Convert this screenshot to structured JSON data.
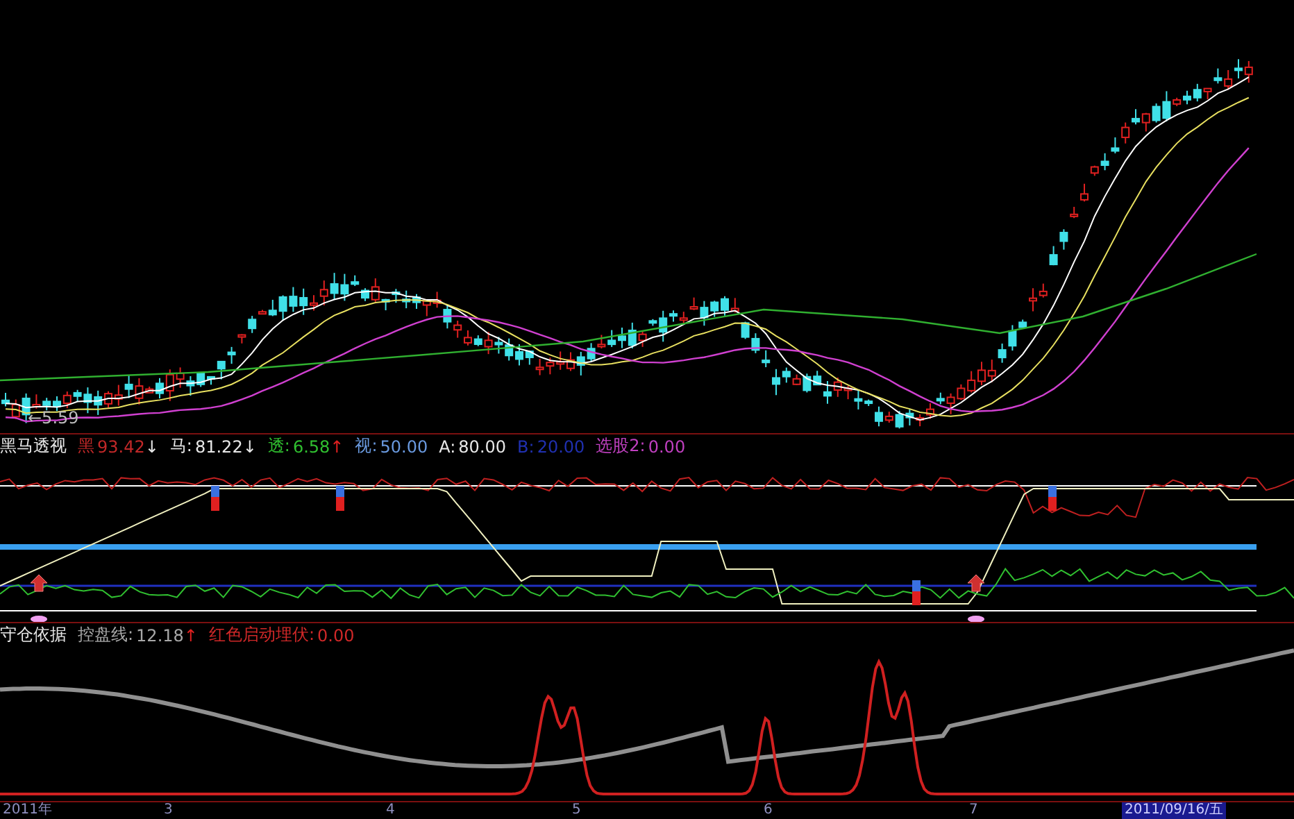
{
  "price_panel": {
    "low_marker": "←5.59"
  },
  "indicator_panel": {
    "title": "黑马透视",
    "items": [
      {
        "label": "黑",
        "value": "93.42",
        "arrow": "↓",
        "color": "#c02828"
      },
      {
        "label": "马:",
        "value": "81.22",
        "arrow": "↓",
        "color": "#e8e8e8"
      },
      {
        "label": "透:",
        "value": "6.58",
        "arrow": "↑",
        "color": "#30c030"
      },
      {
        "label": "视:",
        "value": "50.00",
        "color": "#6a9ae0"
      },
      {
        "label": "A:",
        "value": "80.00",
        "color": "#e8e8e8"
      },
      {
        "label": "B:",
        "value": "20.00",
        "color": "#2030b0"
      },
      {
        "label": "选股2:",
        "value": "0.00",
        "color": "#c040c0"
      }
    ]
  },
  "position_panel": {
    "title": "守仓依据",
    "items": [
      {
        "label": "控盘线:",
        "value": "12.18",
        "arrow": "↑",
        "color": "#a8a8a8"
      },
      {
        "label": "红色启动埋伏:",
        "value": "0.00",
        "color": "#d02828"
      }
    ]
  },
  "time_axis": {
    "labels": [
      "2011年",
      "3",
      "4",
      "5",
      "6",
      "7",
      "2011/09/16/五"
    ]
  }
}
